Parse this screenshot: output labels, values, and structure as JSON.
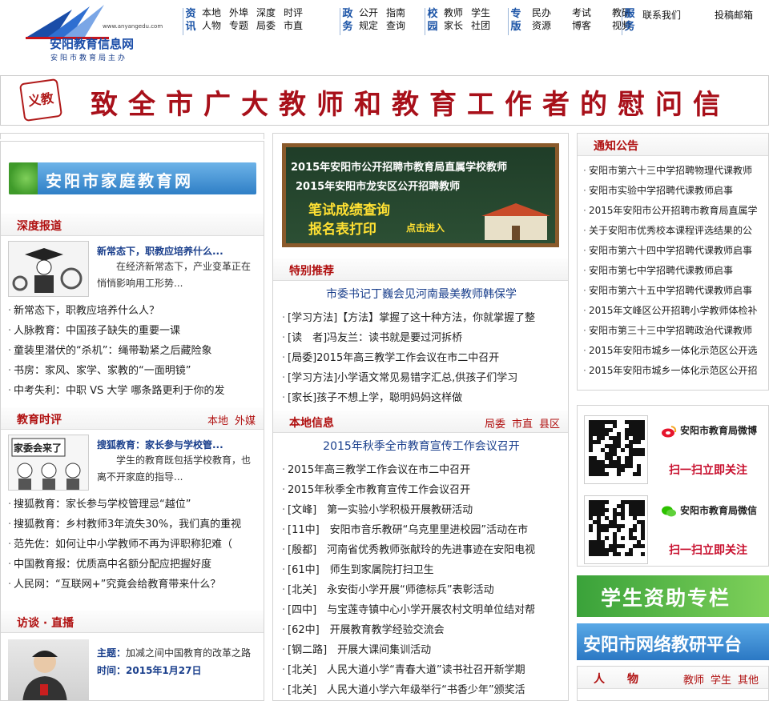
{
  "site": {
    "name": "安阳教育信息网",
    "url": "www.anyangedu.com",
    "sponsor": "安阳市教育局主办"
  },
  "nav": {
    "groups": [
      {
        "cat": "资讯",
        "cols": [
          [
            "本地",
            "人物"
          ],
          [
            "外埠",
            "专题"
          ],
          [
            "深度",
            "局委"
          ],
          [
            "时评",
            "市直"
          ]
        ]
      },
      {
        "cat": "政务",
        "cols": [
          [
            "公开",
            "规定"
          ],
          [
            "指南",
            "查询"
          ]
        ]
      },
      {
        "cat": "校园",
        "cols": [
          [
            "教师",
            "家长"
          ],
          [
            "学生",
            "社团"
          ]
        ]
      },
      {
        "cat": "专版",
        "cols": [
          [
            "民办",
            "资源"
          ],
          [
            "考试",
            "博客"
          ],
          [
            "教研",
            "视频"
          ]
        ]
      },
      {
        "cat": "服务",
        "cols": []
      }
    ],
    "contact": "联系我们",
    "submit": "投稿邮箱"
  },
  "banner": {
    "seal": "义教",
    "text": "致全市广大教师和教育工作者的慰问信"
  },
  "left": {
    "family_banner": "安阳市家庭教育网",
    "sections": [
      {
        "title": "深度报道",
        "feature": {
          "title": "新常态下，职教应培养什么...",
          "desc": "在经济新常态下，产业变革正在悄悄影响用工形势..."
        },
        "items": [
          "新常态下，职教应培养什么人？",
          "人脉教育：中国孩子缺失的重要一课",
          "童装里潜伏的“杀机”：绳带勒紧之后藏险象",
          "书房：家风、家学、家教的“一面明镜”",
          "中考失利：中职 VS 大学 哪条路更利于你的发"
        ]
      },
      {
        "title": "教育时评",
        "more": [
          "本地",
          "外媒"
        ],
        "feature": {
          "title": "搜狐教育：家长参与学校管...",
          "desc": "学生的教育既包括学校教育，也离不开家庭的指导...",
          "img_text": "家委会来了"
        },
        "items": [
          "搜狐教育：家长参与学校管理忌“越位”",
          "搜狐教育：乡村教师3年流失30%，我们真的重视",
          "范先佐：如何让中小学教师不再为评职称犯难（",
          "中国教育报：优质高中名额分配应把握好度",
          "人民网：“互联网+”究竟会给教育带来什么？"
        ]
      },
      {
        "title": "访谈 · 直播",
        "theme_label": "主题：",
        "theme": "加减之间中国教育的改革之路",
        "time_label": "时间：",
        "time": "2015年1月27日"
      }
    ]
  },
  "middle": {
    "board": {
      "line1": "2015年安阳市公开招聘市教育局直属学校教师",
      "line2": "2015年安阳市龙安区公开招聘教师",
      "line3": "笔试成绩查询",
      "line4": "报名表打印",
      "enter": "点击进入"
    },
    "special": {
      "title": "特别推荐",
      "headline": "市委书记丁巍会见河南最美教师韩保学",
      "items": [
        "[学习方法]【方法】掌握了这十种方法，你就掌握了整",
        "[读　者]冯友兰：读书就是要过河拆桥",
        "[局委]2015年高三教学工作会议在市二中召开",
        "[学习方法]小学语文常见易错字汇总,供孩子们学习",
        "[家长]孩子不想上学，聪明妈妈这样做"
      ]
    },
    "local": {
      "title": "本地信息",
      "more": [
        "局委",
        "市直",
        "县区"
      ],
      "headline": "2015年秋季全市教育宣传工作会议召开",
      "items": [
        "2015年高三教学工作会议在市二中召开",
        "2015年秋季全市教育宣传工作会议召开",
        "[文峰]　第一实验小学积极开展教研活动",
        "[11中]　安阳市音乐教研“乌克里里进校园”活动在市",
        "[殷都]　河南省优秀教师张献玲的先进事迹在安阳电视",
        "[61中]　师生到家属院打扫卫生",
        "[北关]　永安街小学开展“师德标兵”表彰活动",
        "[四中]　与宝莲寺镇中心小学开展农村文明单位结对帮",
        "[62中]　开展教育教学经验交流会",
        "[钢二路]　开展大课间集训活动",
        "[北关]　人民大道小学“青春大道”读书社召开新学期",
        "[北关]　人民大道小学六年级举行“书香少年”颁奖活"
      ]
    }
  },
  "right": {
    "notice": {
      "title": "通知公告",
      "items": [
        "安阳市第六十三中学招聘物理代课教师",
        "安阳市实验中学招聘代课教师启事",
        "2015年安阳市公开招聘市教育局直属学",
        "关于安阳市优秀校本课程评选结果的公",
        "安阳市第六十四中学招聘代课教师启事",
        "安阳市第七中学招聘代课教师启事",
        "安阳市第六十五中学招聘代课教师启事",
        "2015年文峰区公开招聘小学教师体检补",
        "安阳市第三十三中学招聘政治代课教师",
        "2015年安阳市城乡一体化示范区公开选",
        "2015年安阳市城乡一体化示范区公开招"
      ]
    },
    "weibo": {
      "label": "安阳市教育局微博",
      "cta": "扫一扫立即关注"
    },
    "weixin": {
      "label": "安阳市教育局微信",
      "cta": "扫一扫立即关注"
    },
    "aid_banner": "学生资助专栏",
    "research_banner": "安阳市网络教研平台",
    "people": {
      "title": "人　　物",
      "more": [
        "教师",
        "学生",
        "其他"
      ]
    }
  },
  "colors": {
    "accent": "#b01010",
    "link": "#1a3f8c",
    "nav": "#1a53a6"
  }
}
